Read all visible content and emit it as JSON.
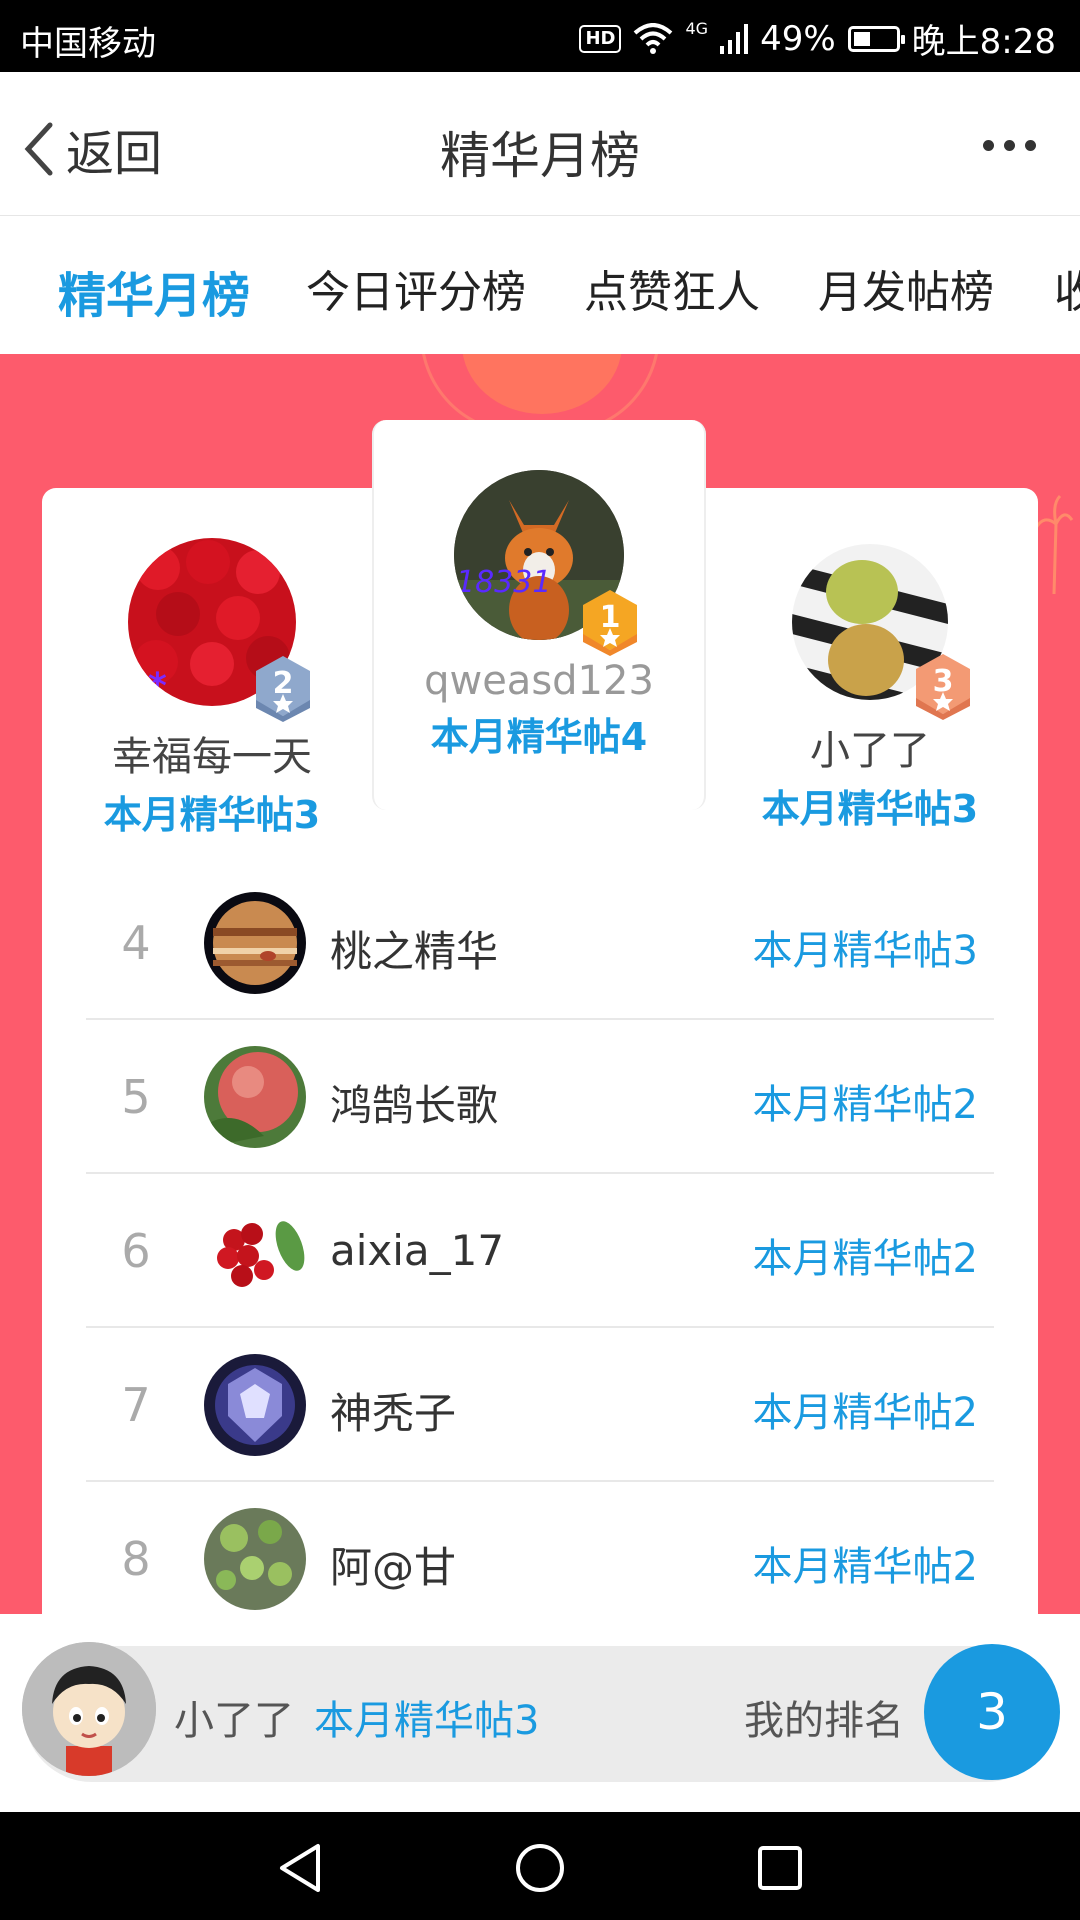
{
  "status_bar": {
    "carrier": "中国移动",
    "network": "4G",
    "hd": "HD",
    "battery": "49%",
    "time": "晚上8:28"
  },
  "header": {
    "back_label": "返回",
    "title": "精华月榜"
  },
  "tabs": [
    {
      "label": "精华月榜",
      "active": true
    },
    {
      "label": "今日评分榜"
    },
    {
      "label": "点赞狂人"
    },
    {
      "label": "月发帖榜"
    },
    {
      "label": "收"
    }
  ],
  "podium": [
    {
      "rank": "1",
      "name": "qweasd123",
      "count": "本月精华帖4"
    },
    {
      "rank": "2",
      "name": "幸福每一天",
      "count": "本月精华帖3"
    },
    {
      "rank": "3",
      "name": "小了了",
      "count": "本月精华帖3"
    }
  ],
  "list": [
    {
      "rank": "4",
      "name": "桃之精华",
      "count": "本月精华帖3"
    },
    {
      "rank": "5",
      "name": "鸿鹄长歌",
      "count": "本月精华帖2"
    },
    {
      "rank": "6",
      "name": "aixia_17",
      "count": "本月精华帖2"
    },
    {
      "rank": "7",
      "name": "神秃子",
      "count": "本月精华帖2"
    },
    {
      "rank": "8",
      "name": "阿@甘",
      "count": "本月精华帖2"
    }
  ],
  "my_rank": {
    "name": "小了了",
    "count": "本月精华帖3",
    "label": "我的排名",
    "rank": "3"
  },
  "colors": {
    "accent": "#1a9ae0",
    "banner": "#fd5b6c",
    "gold": "#f5a623",
    "silver": "#7d99c4",
    "bronze": "#f08a5d"
  }
}
